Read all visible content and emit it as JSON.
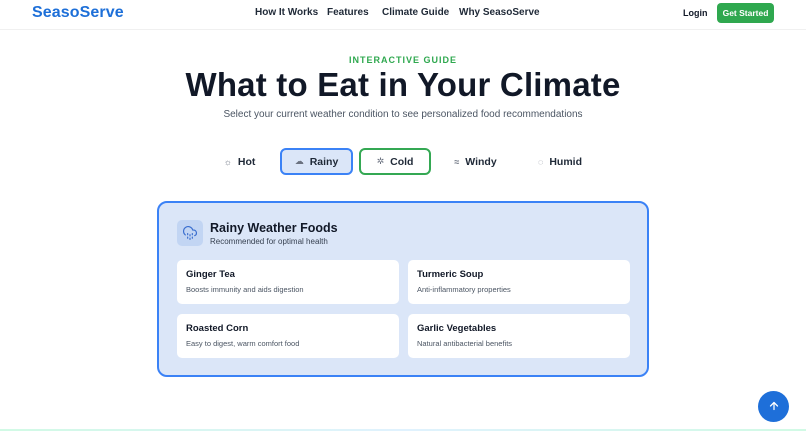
{
  "nav": {
    "logo": "SeasoServe",
    "links": [
      "How It Works",
      "Features",
      "Climate Guide",
      "Why SeasoServe"
    ],
    "login": "Login",
    "cta": "Get Started"
  },
  "hero": {
    "eyebrow": "INTERACTIVE GUIDE",
    "title": "What to Eat in Your Climate",
    "subtitle": "Select your current weather condition to see personalized food recommendations"
  },
  "tabs": [
    {
      "label": "Hot",
      "icon": "sun-icon",
      "glyph": "☼",
      "state": "default"
    },
    {
      "label": "Rainy",
      "icon": "cloud-rain-icon",
      "glyph": "☁",
      "state": "selected"
    },
    {
      "label": "Cold",
      "icon": "snowflake-icon",
      "glyph": "✲",
      "state": "highlighted"
    },
    {
      "label": "Windy",
      "icon": "wind-icon",
      "glyph": "≈",
      "state": "default"
    },
    {
      "label": "Humid",
      "icon": "droplet-icon",
      "glyph": "◌",
      "state": "default"
    }
  ],
  "panel": {
    "icon": "cloud-rain-icon",
    "title": "Rainy Weather Foods",
    "subtitle": "Recommended for optimal health",
    "items": [
      {
        "name": "Ginger Tea",
        "desc": "Boosts immunity and aids digestion"
      },
      {
        "name": "Turmeric Soup",
        "desc": "Anti-inflammatory properties"
      },
      {
        "name": "Roasted Corn",
        "desc": "Easy to digest, warm comfort food"
      },
      {
        "name": "Garlic Vegetables",
        "desc": "Natural antibacterial benefits"
      }
    ]
  },
  "colors": {
    "brand": "#1d6fd8",
    "accent": "#2fa84f",
    "panel_bg": "#dbe6f8",
    "panel_border": "#3b82f6"
  },
  "fab": {
    "icon": "arrow-up-icon"
  }
}
